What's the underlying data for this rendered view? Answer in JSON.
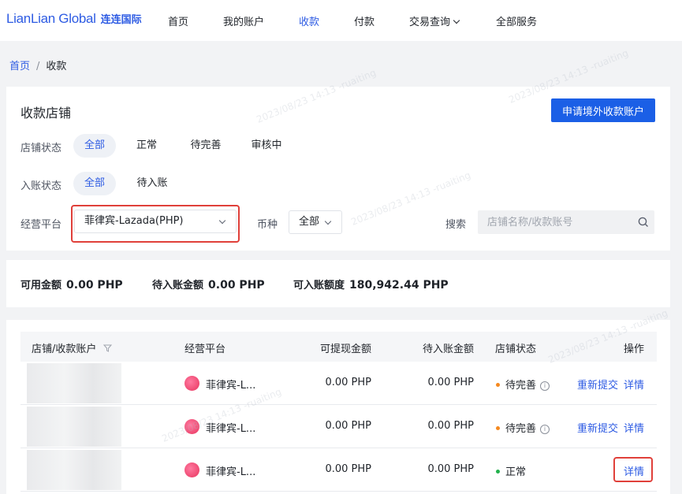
{
  "nav": {
    "logo_en": "LianLian Global",
    "logo_cn": "连连国际",
    "items": [
      {
        "label": "首页",
        "active": false
      },
      {
        "label": "我的账户",
        "active": false
      },
      {
        "label": "收款",
        "active": true
      },
      {
        "label": "付款",
        "active": false
      },
      {
        "label": "交易查询",
        "active": false,
        "dropdown": true
      },
      {
        "label": "全部服务",
        "active": false
      }
    ]
  },
  "breadcrumb": {
    "home": "首页",
    "separator": "/",
    "current": "收款"
  },
  "filter": {
    "title": "收款店铺",
    "apply_button": "申请境外收款账户",
    "store_status": {
      "label": "店铺状态",
      "options": [
        "全部",
        "正常",
        "待完善",
        "审核中"
      ],
      "selected": "全部"
    },
    "account_status": {
      "label": "入账状态",
      "options": [
        "全部",
        "待入账"
      ],
      "selected": "全部"
    },
    "platform": {
      "label": "经营平台",
      "value": "菲律宾-Lazada(PHP)"
    },
    "currency": {
      "label": "币种",
      "value": "全部"
    },
    "search": {
      "label": "搜索",
      "placeholder": "店铺名称/收款账号"
    }
  },
  "balances": [
    {
      "label": "可用金额",
      "value": "0.00 PHP"
    },
    {
      "label": "待入账金额",
      "value": "0.00 PHP"
    },
    {
      "label": "可入账额度",
      "value": "180,942.44 PHP"
    }
  ],
  "table": {
    "headers": [
      "店铺/收款账户",
      "经营平台",
      "可提现金额",
      "待入账金额",
      "店铺状态",
      "操作"
    ],
    "rows": [
      {
        "platform": "菲律宾-L...",
        "withdrawable": "0.00 PHP",
        "pending": "0.00 PHP",
        "status": "待完善",
        "status_color": "#f5891f",
        "resubmit": "重新提交",
        "detail": "详情"
      },
      {
        "platform": "菲律宾-L...",
        "withdrawable": "0.00 PHP",
        "pending": "0.00 PHP",
        "status": "待完善",
        "status_color": "#f5891f",
        "resubmit": "重新提交",
        "detail": "详情"
      },
      {
        "platform": "菲律宾-L...",
        "withdrawable": "0.00 PHP",
        "pending": "0.00 PHP",
        "status": "正常",
        "status_color": "#22b14c",
        "resubmit": "",
        "detail": "详情"
      }
    ]
  },
  "watermark": "2023/08/23 14:13 -ruaiting",
  "colors": {
    "accent": "#2d5be3",
    "primary_button": "#1b5fe6",
    "highlight_border": "#e0403a"
  }
}
